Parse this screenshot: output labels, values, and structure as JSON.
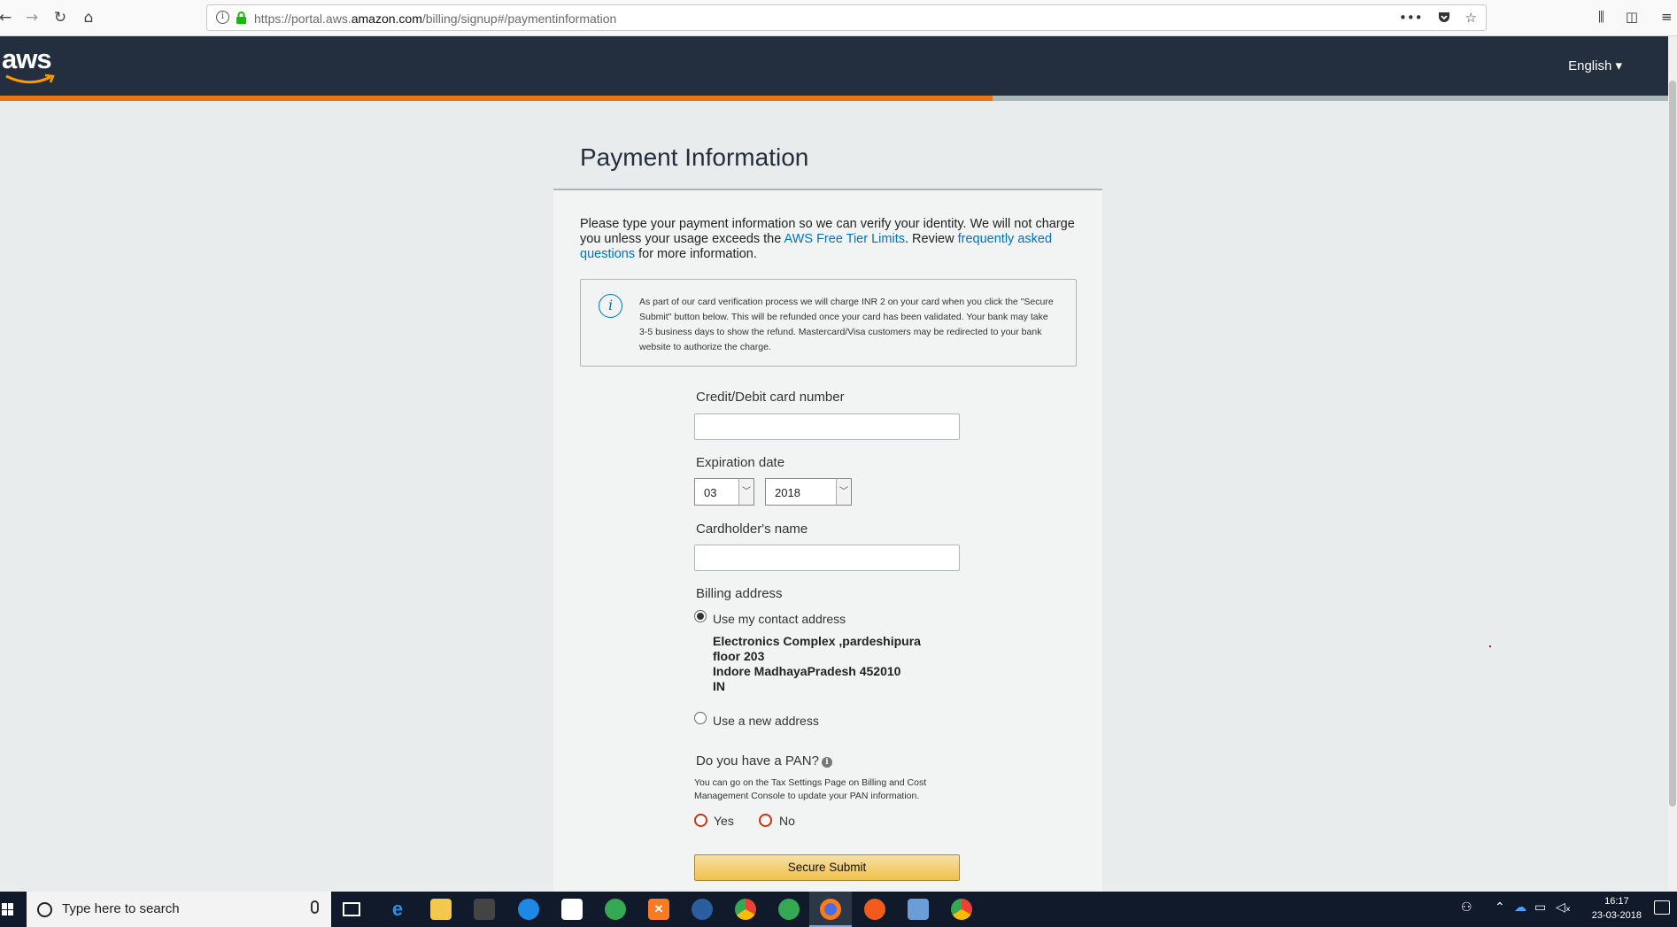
{
  "browser": {
    "url_prefix": "https://portal.aws.",
    "url_domain": "amazon.com",
    "url_path": "/billing/signup#/paymentinformation",
    "nav_icons": [
      "back-icon",
      "forward-icon",
      "reload-icon",
      "home-icon"
    ],
    "action_icons": [
      "more-icon",
      "pocket-icon",
      "bookmark-star-icon",
      "library-icon",
      "sidebar-icon",
      "menu-icon"
    ]
  },
  "header": {
    "logo": "aws",
    "language": "English ▾",
    "signup_progress_percent": 59.5
  },
  "page": {
    "title": "Payment Information",
    "intro_before": "Please type your payment information so we can verify your identity. We will not charge you unless your usage exceeds the ",
    "intro_link1": "AWS Free Tier Limits",
    "intro_middle": ". Review ",
    "intro_link2": "frequently asked questions",
    "intro_after": " for more information.",
    "notice": "As part of our card verification process we will charge INR 2 on your card when you click the \"Secure Submit\" button below. This will be refunded once your card has been validated. Your bank may take 3-5 business days to show the refund. Mastercard/Visa customers may be redirected to your bank website to authorize the charge."
  },
  "form": {
    "card_number_label": "Credit/Debit card number",
    "card_number_value": "",
    "expiration_label": "Expiration date",
    "exp_month": "03",
    "exp_year": "2018",
    "cardholder_label": "Cardholder's name",
    "cardholder_value": "",
    "billing_label": "Billing address",
    "use_contact_label": "Use my contact address",
    "address_lines": [
      "Electronics Complex ,pardeshipura",
      "floor 203",
      "Indore MadhayaPradesh 452010",
      "IN"
    ],
    "use_new_label": "Use a new address",
    "pan_question": "Do you have a PAN?",
    "pan_help": "You can go on the Tax Settings Page on Billing and Cost Management Console to update your PAN information.",
    "pan_yes": "Yes",
    "pan_no": "No",
    "submit_label": "Secure Submit"
  },
  "taskbar": {
    "search_placeholder": "Type here to search",
    "time": "16:17",
    "date": "23-03-2018",
    "accent": "#7aa7e0"
  },
  "colors": {
    "header_bg": "#232f3e",
    "progress": "#ec7211",
    "link": "#0073bb",
    "submit": "#f0c14b"
  }
}
